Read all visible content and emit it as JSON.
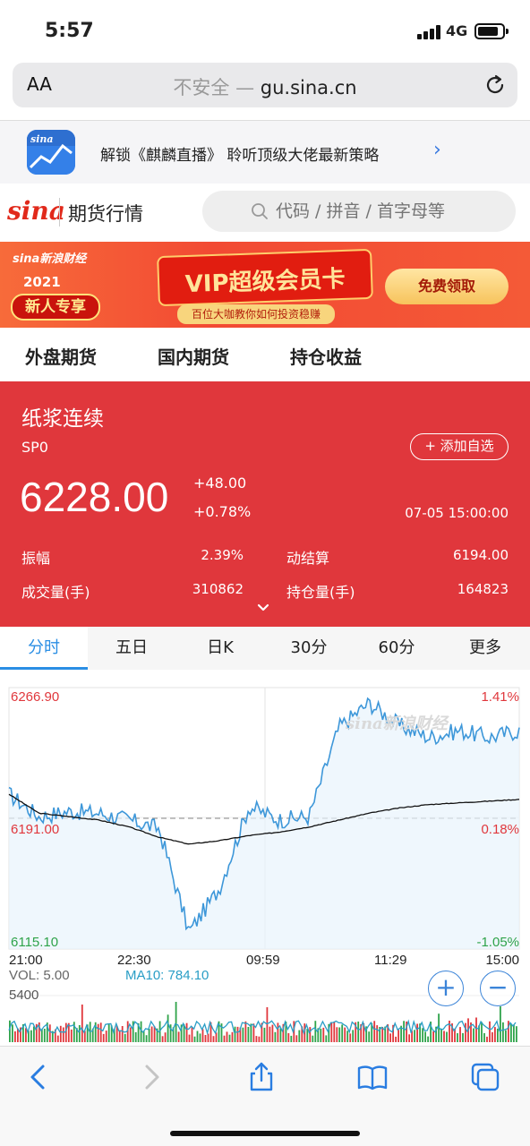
{
  "status_bar": {
    "time": "5:57",
    "network": "4G"
  },
  "browser": {
    "text_size_label": "AA",
    "insecure_label": "不安全",
    "separator": " — ",
    "domain": "gu.sina.cn"
  },
  "app_banner": {
    "text": "解锁《麒麟直播》 聆听顶级大佬最新策略"
  },
  "site_header": {
    "logo": "sina",
    "title": "期货行情",
    "search_placeholder": "代码 / 拼音 / 首字母等"
  },
  "promo_banner": {
    "logo": "sina新浪财经",
    "year": "2021",
    "badge": "新人专享",
    "card_title": "VIP超级会员卡",
    "card_sub": "百位大咖教你如何投资稳赚",
    "button": "免费领取"
  },
  "category_tabs": [
    "外盘期货",
    "国内期货",
    "持仓收益"
  ],
  "quote": {
    "name": "纸浆连续",
    "code": "SP0",
    "add_watch": "+ 添加自选",
    "price": "6228.00",
    "change": "+48.00",
    "change_pct": "+0.78%",
    "timestamp": "07-05 15:00:00",
    "stats": [
      {
        "label": "振幅",
        "value": "2.39%"
      },
      {
        "label": "动结算",
        "value": "6194.00"
      },
      {
        "label": "成交量(手)",
        "value": "310862"
      },
      {
        "label": "持仓量(手)",
        "value": "164823"
      }
    ]
  },
  "period_tabs": [
    "分时",
    "五日",
    "日K",
    "30分",
    "60分",
    "更多"
  ],
  "chart": {
    "watermark": "sina新浪财经",
    "price_high": "6266.90",
    "price_ref": "6191.00",
    "price_low": "6115.10",
    "pct_high": "1.41%",
    "pct_ref": "0.18%",
    "pct_low": "-1.05%",
    "time_labels": [
      "21:00",
      "22:30",
      "09:59",
      "11:29",
      "15:00"
    ],
    "vol_label": "VOL: 5.00",
    "ma_label": "MA10: 784.10",
    "vol_max": "5400"
  },
  "chart_data": {
    "type": "line",
    "x": [
      "21:00",
      "22:30",
      "09:59",
      "11:29",
      "15:00"
    ],
    "ylim": [
      6115.1,
      6266.9
    ],
    "reference": 6191.0,
    "series": [
      {
        "values": [
          6191,
          6187,
          6130,
          6196,
          6258,
          6240
        ]
      },
      {
        "values": [
          6205,
          6190,
          6175,
          6185,
          6196,
          6201
        ]
      }
    ],
    "colors": {
      "price": "#3d97d9",
      "avg": "#111111",
      "up": "#e0373c",
      "down": "#2fa34a"
    }
  },
  "colors": {
    "accent": "#2a8ee4",
    "quote_bg": "#e0373c",
    "sina_red": "#e1291b"
  }
}
